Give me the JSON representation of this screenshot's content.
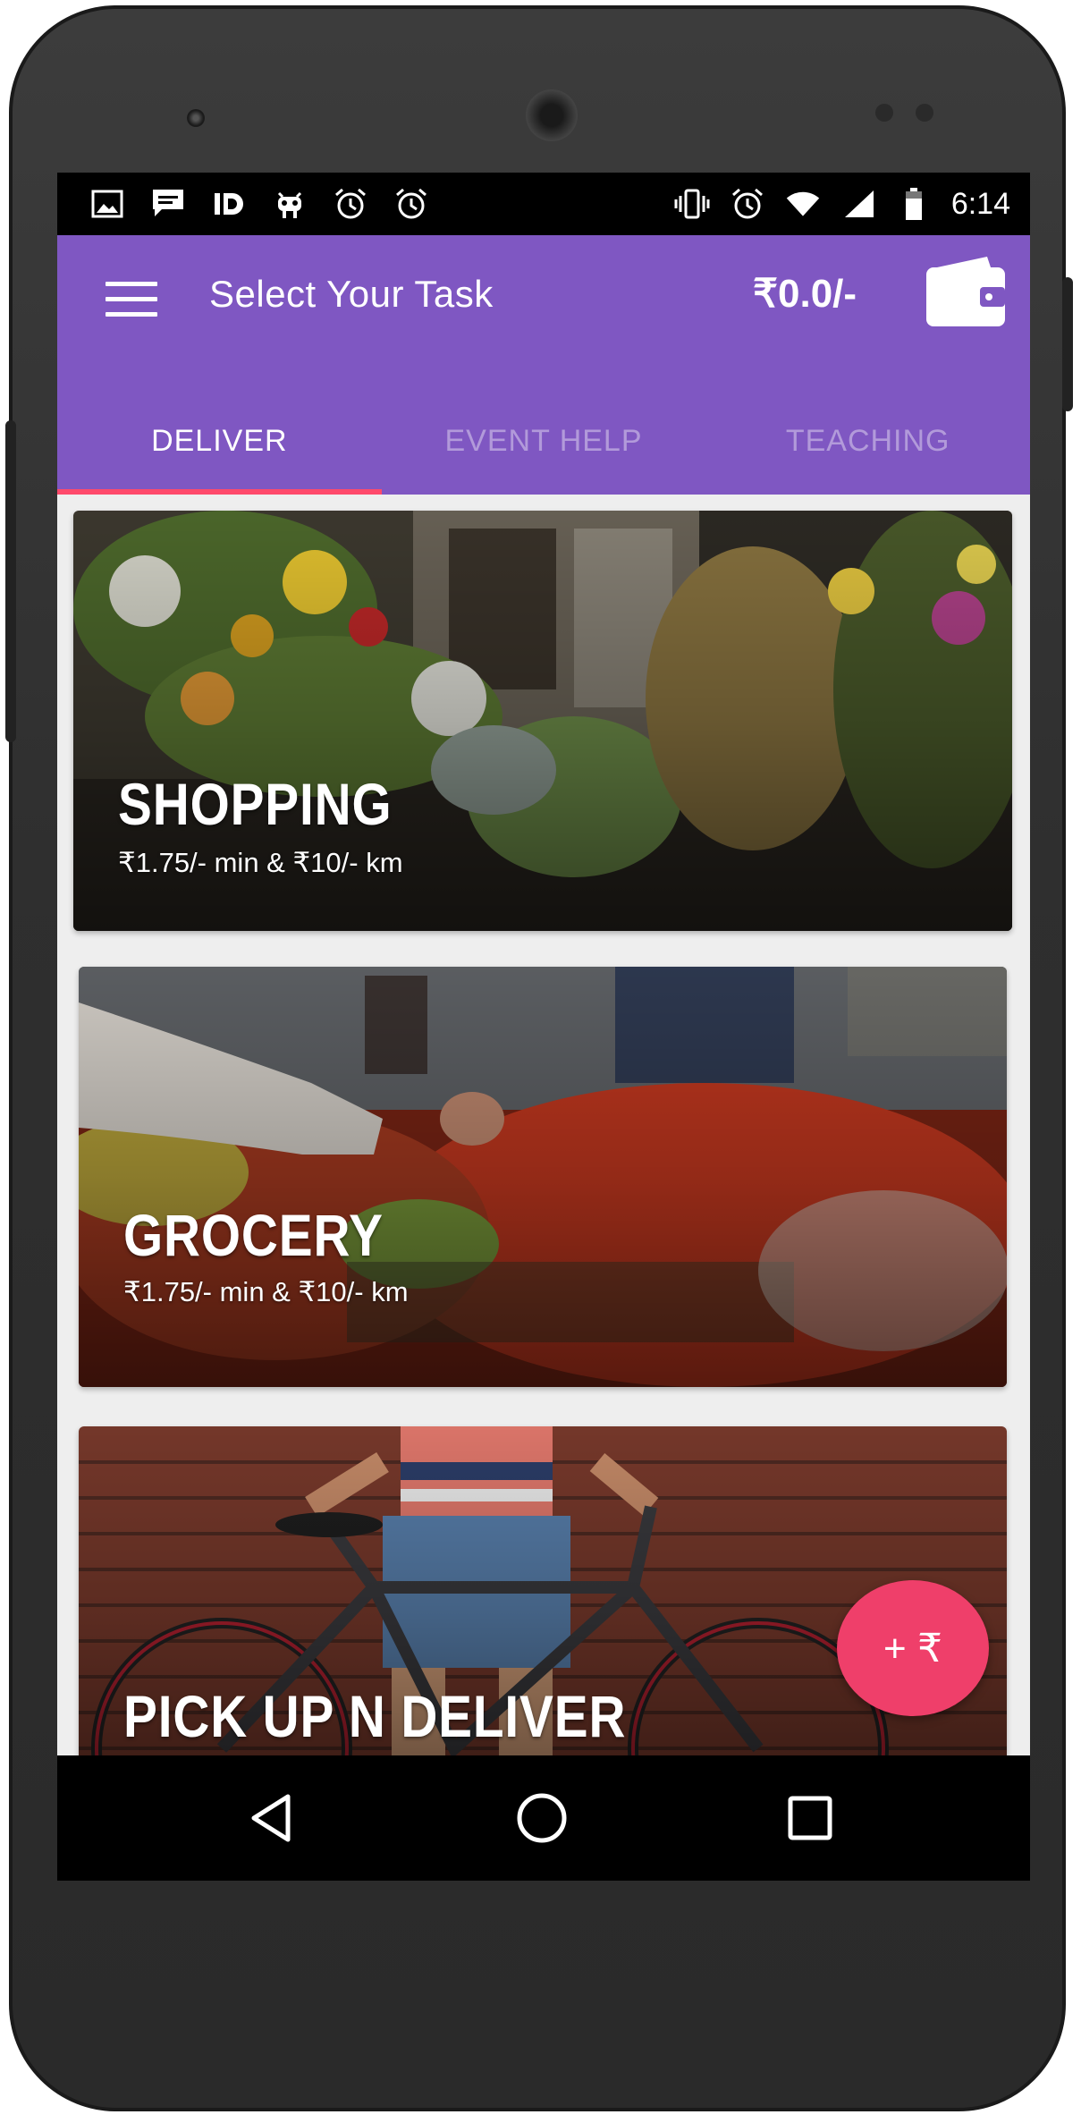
{
  "status_bar": {
    "left_icons": [
      "image-icon",
      "chat-icon",
      "id-icon",
      "android-icon",
      "alarm-icon",
      "alarm-icon"
    ],
    "right_icons": [
      "vibrate-icon",
      "alarm-icon",
      "wifi-icon",
      "signal-icon",
      "battery-icon"
    ],
    "time": "6:14"
  },
  "app_bar": {
    "menu_icon": "hamburger-menu-icon",
    "title": "Select Your Task",
    "balance": "₹0.0/-",
    "wallet_icon": "wallet-icon"
  },
  "tabs": [
    {
      "label": "DELIVER",
      "active": true
    },
    {
      "label": "EVENT HELP",
      "active": false
    },
    {
      "label": "TEACHING",
      "active": false
    }
  ],
  "cards": [
    {
      "title": "SHOPPING",
      "rate": "₹1.75/- min & ₹10/- km"
    },
    {
      "title": "GROCERY",
      "rate": "₹1.75/- min & ₹10/- km"
    },
    {
      "title": "PICK UP N DELIVER"
    }
  ],
  "fab": {
    "label": "+ ₹"
  },
  "colors": {
    "primary": "#7f57c2",
    "tab_indicator": "#ff4a6b",
    "fab": "#ef3f6a",
    "background": "#eeeeee"
  },
  "nav_bar": {
    "icons": [
      "back-icon",
      "home-icon",
      "recents-icon"
    ]
  }
}
